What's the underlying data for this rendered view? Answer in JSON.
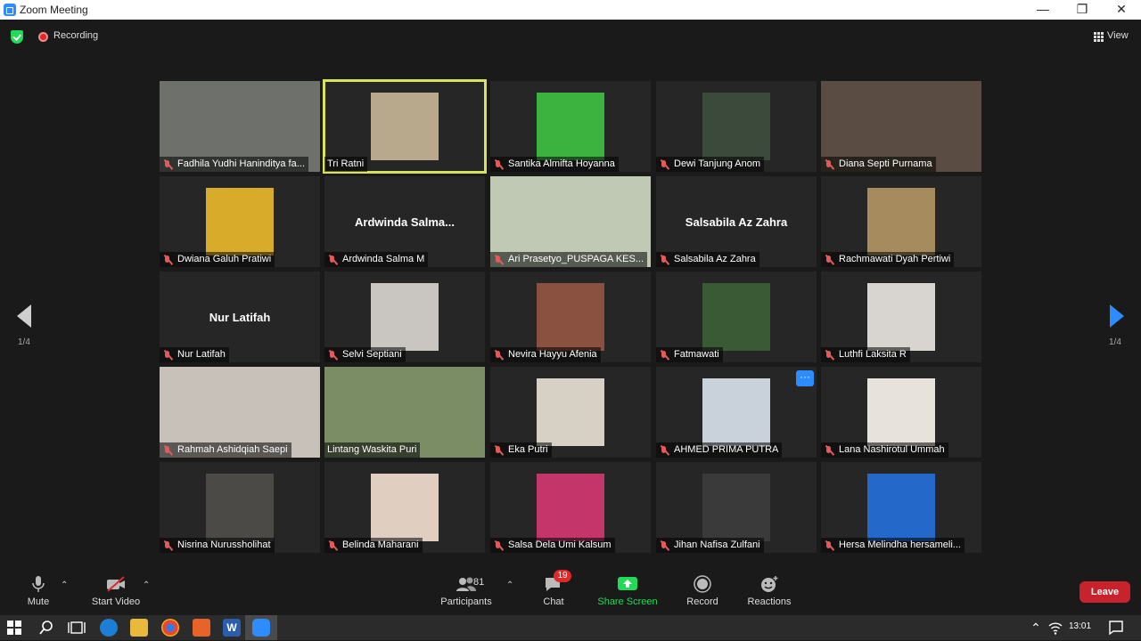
{
  "window": {
    "title": "Zoom Meeting",
    "minimize": "—",
    "restore": "❐",
    "close": "✕"
  },
  "topbar": {
    "recording_label": "Recording",
    "view_label": "View"
  },
  "pagination": {
    "left": "1/4",
    "right": "1/4"
  },
  "participants_grid": [
    {
      "name": "Fadhila Yudhi Hanindityа fa...",
      "type": "video",
      "muted": true,
      "color": "#6e716b"
    },
    {
      "name": "Tri Ratni",
      "type": "photo",
      "muted": false,
      "active": true,
      "color": "#b9a98c"
    },
    {
      "name": "Santika Almifta Hoyanna",
      "type": "photo",
      "muted": true,
      "color": "#3bb33e"
    },
    {
      "name": "Dewi Tanjung Anom",
      "type": "photo",
      "muted": true,
      "color": "#3b4a3a"
    },
    {
      "name": "Diana Septi Purnama",
      "type": "video",
      "muted": true,
      "color": "#5a4c42"
    },
    {
      "name": "Dwiana Galuh Pratiwi",
      "type": "photo",
      "muted": true,
      "color": "#d9ab2a"
    },
    {
      "name": "Ardwinda Salma M",
      "display": "Ardwinda  Salma...",
      "type": "name",
      "muted": true
    },
    {
      "name": "Ari Prasetyo_PUSPAGA KES...",
      "type": "video",
      "muted": true,
      "color": "#bfc9b4"
    },
    {
      "name": "Salsabila Az Zahra",
      "display": "Salsabila Az Zahra",
      "type": "name",
      "muted": true
    },
    {
      "name": "Rachmawati Dyah Pertiwi",
      "type": "photo",
      "muted": true,
      "color": "#a68b5f"
    },
    {
      "name": "Nur Latifah",
      "display": "Nur Latifah",
      "type": "name",
      "muted": true
    },
    {
      "name": "Selvi Septiani",
      "type": "photo",
      "muted": true,
      "color": "#c9c6c1"
    },
    {
      "name": "Nevira Hayyu Afenia",
      "type": "photo",
      "muted": true,
      "color": "#8a5140"
    },
    {
      "name": "Fatmawati",
      "type": "photo",
      "muted": true,
      "color": "#3a5a35"
    },
    {
      "name": "Luthfi Laksita R",
      "type": "photo",
      "muted": true,
      "color": "#d8d4cf"
    },
    {
      "name": "Rahmah Ashidqiah Saepi",
      "type": "video",
      "muted": true,
      "color": "#c7c1ba"
    },
    {
      "name": "Lintang Waskita Puri",
      "type": "video",
      "muted": false,
      "color": "#7a8d65"
    },
    {
      "name": "Eka Putri",
      "type": "photo",
      "muted": true,
      "color": "#d6d0c5"
    },
    {
      "name": "AHMED PRIMA PUTRA",
      "type": "photo",
      "muted": true,
      "more": true,
      "color": "#c9d1da"
    },
    {
      "name": "Lana Nashirotul Ummah",
      "type": "photo",
      "muted": true,
      "color": "#e8e2dc"
    },
    {
      "name": "Nisrina Nurussholihat",
      "type": "photo",
      "muted": true,
      "color": "#4b4a47"
    },
    {
      "name": "Belinda Maharani",
      "type": "photo",
      "muted": true,
      "color": "#e0cfc0"
    },
    {
      "name": "Salsa Dela Umi Kalsum",
      "type": "photo",
      "muted": true,
      "color": "#c4356a"
    },
    {
      "name": "Jihan Nafisa Zulfani",
      "type": "photo",
      "muted": true,
      "color": "#3a3a3a"
    },
    {
      "name": "Hersa Melindha hersameli...",
      "type": "photo",
      "muted": true,
      "color": "#2469c9"
    }
  ],
  "toolbar": {
    "mute": "Mute",
    "start_video": "Start Video",
    "participants": "Participants",
    "participants_count": "81",
    "chat": "Chat",
    "chat_badge": "19",
    "share_screen": "Share Screen",
    "record": "Record",
    "reactions": "Reactions",
    "leave": "Leave"
  },
  "tile_more_label": "···",
  "taskbar": {
    "time": "13:01"
  },
  "colors": {
    "accent": "#2d8cff",
    "active_speaker": "#d7e35a",
    "leave": "#c8232c",
    "share": "#23d959"
  }
}
